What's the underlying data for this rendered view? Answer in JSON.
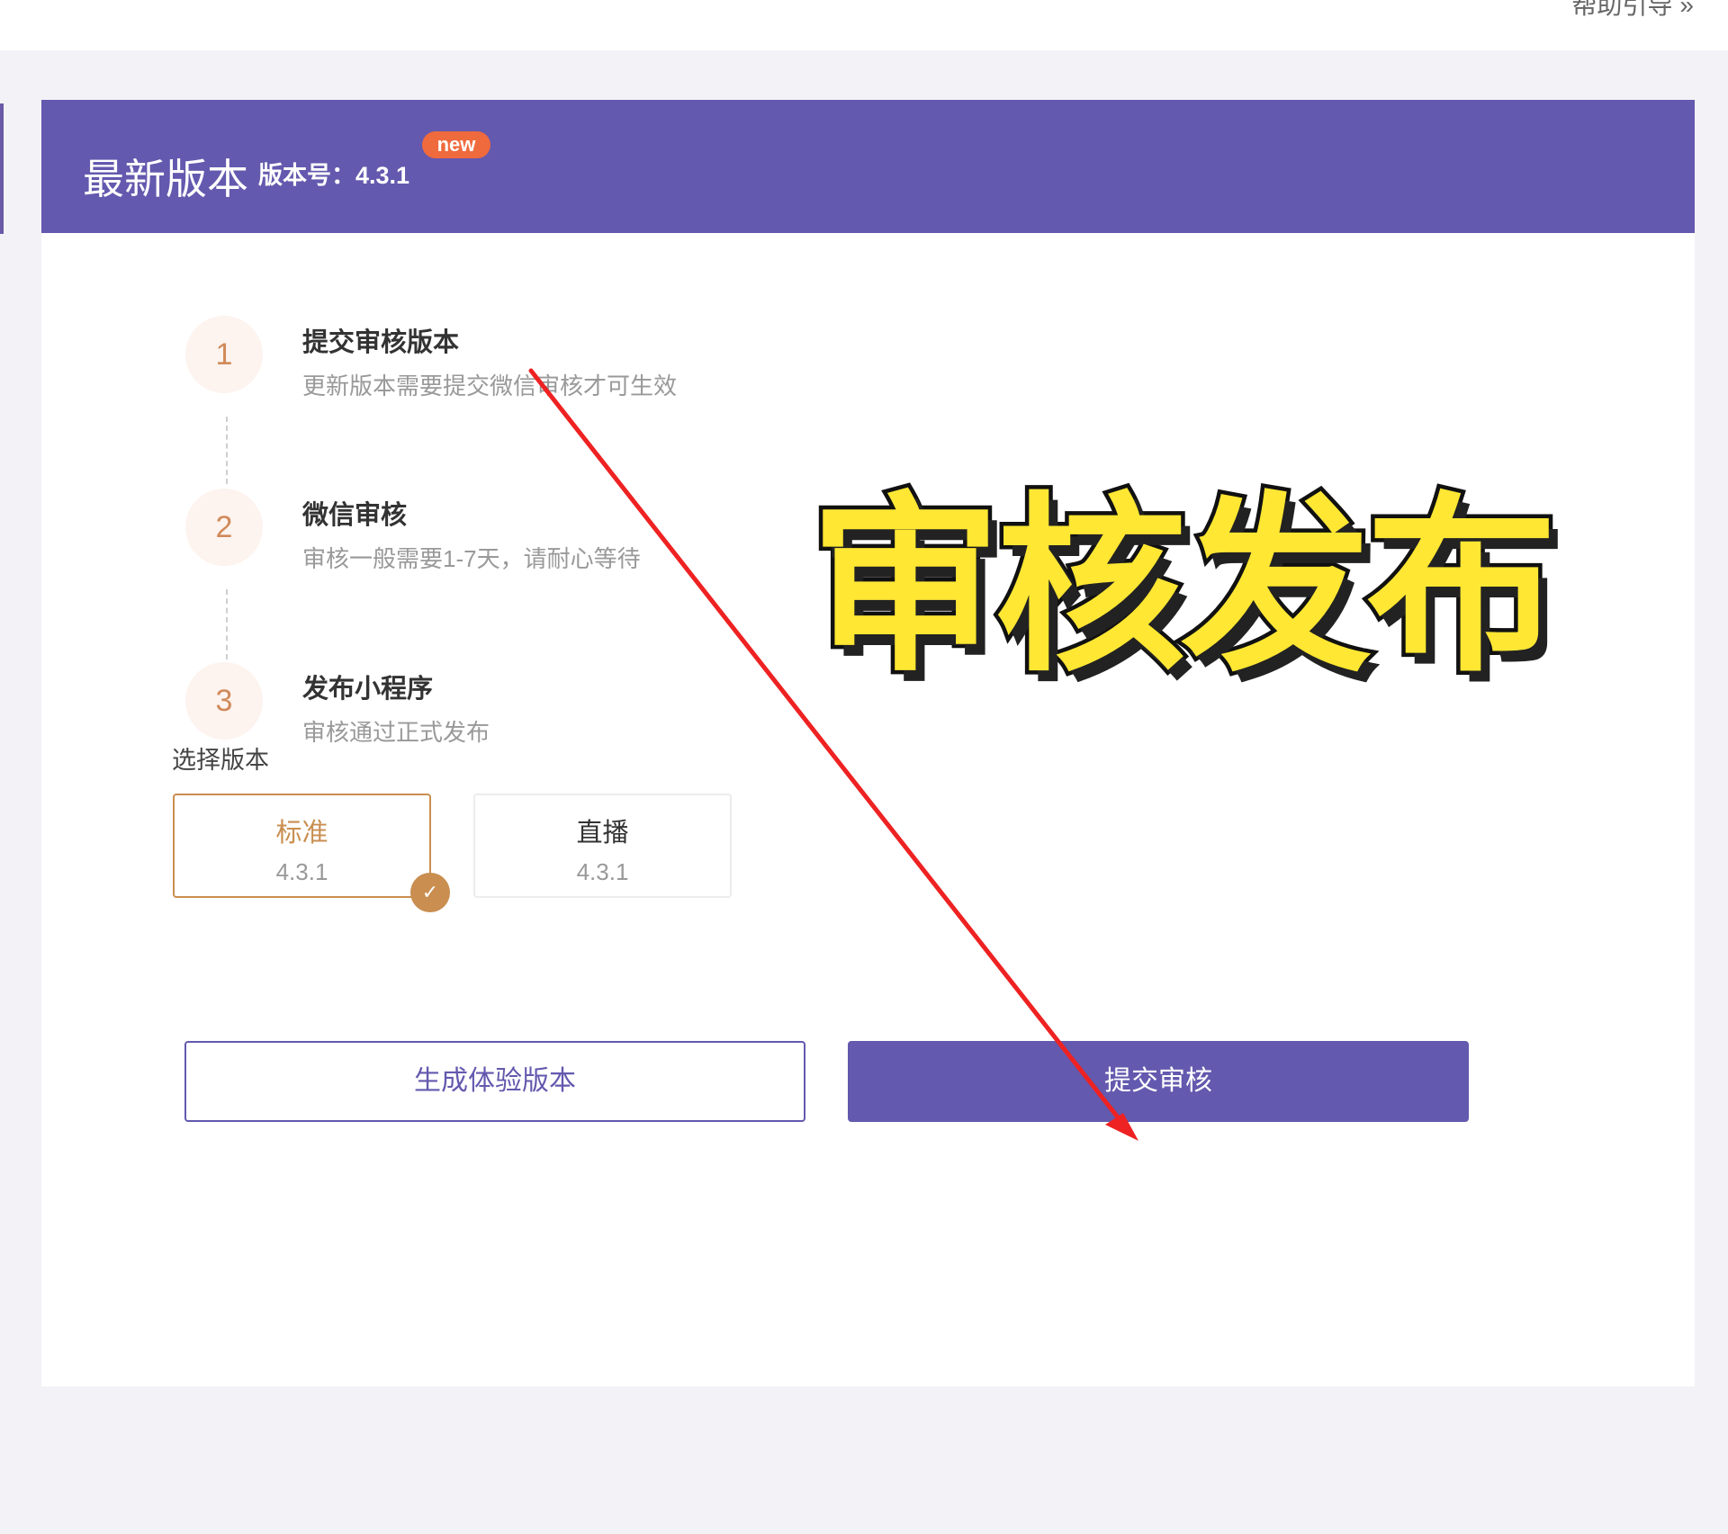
{
  "topbar": {
    "help_label": "帮助引导",
    "help_chevron": "»"
  },
  "header": {
    "title": "最新版本",
    "version_label": "版本号：4.3.1",
    "badge": "new"
  },
  "steps": [
    {
      "num": "1",
      "title": "提交审核版本",
      "desc": "更新版本需要提交微信审核才可生效"
    },
    {
      "num": "2",
      "title": "微信审核",
      "desc": "审核一般需要1-7天，请耐心等待"
    },
    {
      "num": "3",
      "title": "发布小程序",
      "desc": "审核通过正式发布"
    }
  ],
  "choose": {
    "label": "选择版本",
    "options": [
      {
        "name": "标准",
        "version": "4.3.1",
        "selected": true
      },
      {
        "name": "直播",
        "version": "4.3.1",
        "selected": false
      }
    ]
  },
  "buttons": {
    "trial": "生成体验版本",
    "submit": "提交审核"
  },
  "overlay": {
    "caption": "审核发布"
  },
  "colors": {
    "primary": "#6359ae",
    "accent": "#c98e50",
    "badge": "#ef6a3c",
    "arrow": "#ee2222",
    "caption": "#ffe733"
  },
  "icons": {
    "check": "check-icon",
    "arrow": "red-arrow-annotation"
  }
}
